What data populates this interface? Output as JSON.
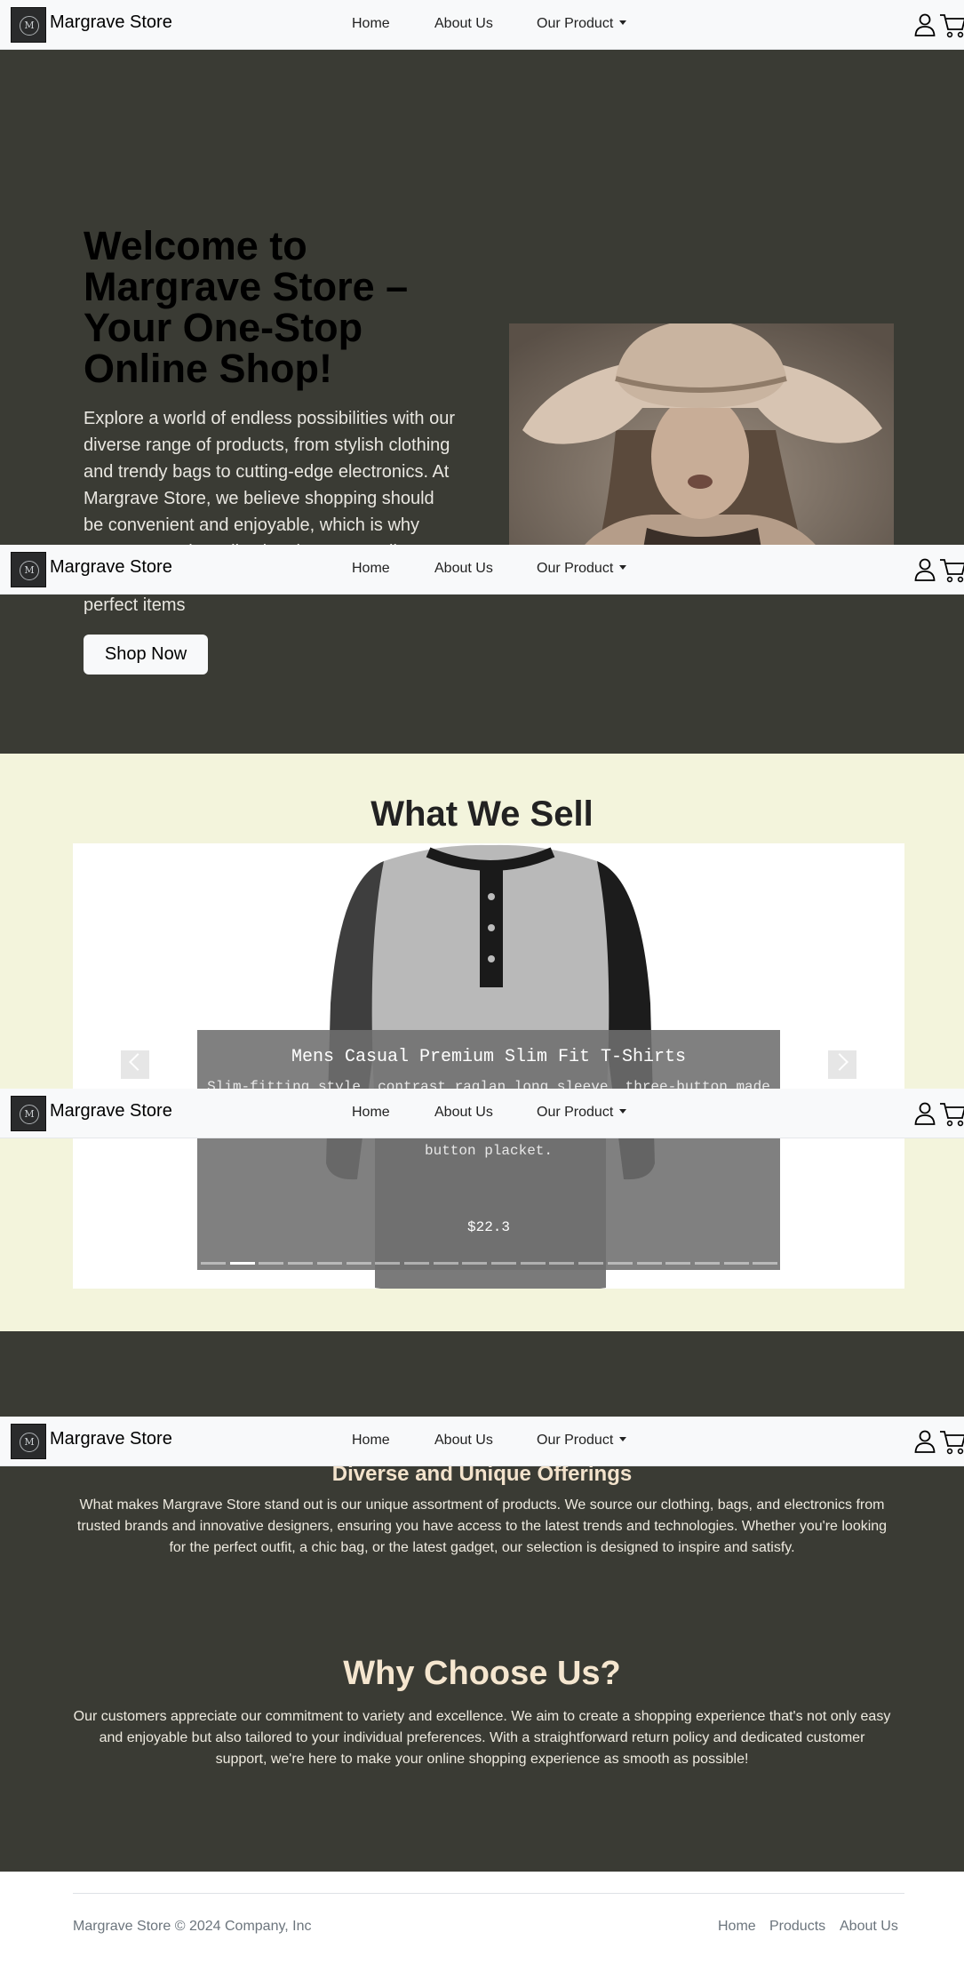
{
  "navbar": {
    "brand": "Margrave Store",
    "logo_letter": "M",
    "links": {
      "home": "Home",
      "about": "About Us",
      "product": "Our Product"
    },
    "icons": {
      "user": "user-icon",
      "cart": "cart-icon",
      "dropdown": "caret-down-icon"
    }
  },
  "hero": {
    "title": "Welcome to Margrave Store – Your One-Stop Online Shop!",
    "text": "Explore a world of endless possibilities with our diverse range of products, from stylish clothing and trendy bags to cutting-edge electronics. At Margrave Store, we believe shopping should be convenient and enjoyable, which is why we've curated a collection that meets all your needs in one place. Dive in and discover the perfect items",
    "button": "Shop Now",
    "image": "woman-in-hat-photo"
  },
  "sell": {
    "title": "What We Sell",
    "slide": {
      "title": "Mens Casual Premium Slim Fit T-Shirts",
      "description": "Slim-fitting style, contrast raglan long sleeve, three-button made for durability and a great fit for casual fashion wear and diehard baseball fans. The Henley style round neckline includes a three-button placket.",
      "price": "$22.3",
      "image": "raglan-henley-shirt-photo"
    },
    "indicator_count": 20,
    "active_indicator": 1
  },
  "info": {
    "offer_title": "Diverse and Unique Offerings",
    "offer_text": "What makes Margrave Store stand out is our unique assortment of products. We source our clothing, bags, and electronics from trusted brands and innovative designers, ensuring you have access to the latest trends and technologies. Whether you're looking for the perfect outfit, a chic bag, or the latest gadget, our selection is designed to inspire and satisfy.",
    "why_title": "Why Choose Us?",
    "why_text": "Our customers appreciate our commitment to variety and excellence. We aim to create a shopping experience that's not only easy and enjoyable but also tailored to your individual preferences. With a straightforward return policy and dedicated customer support, we're here to make your online shopping experience as smooth as possible!"
  },
  "footer": {
    "copyright": "Margrave Store © 2024 Company, Inc",
    "links": {
      "home": "Home",
      "products": "Products",
      "about": "About Us"
    }
  },
  "colors": {
    "dark_bg": "#3a3b34",
    "cream_bg": "#f3f4dc",
    "navbar_bg": "#f8f9fa",
    "heading_cream": "#f5e6cf"
  }
}
